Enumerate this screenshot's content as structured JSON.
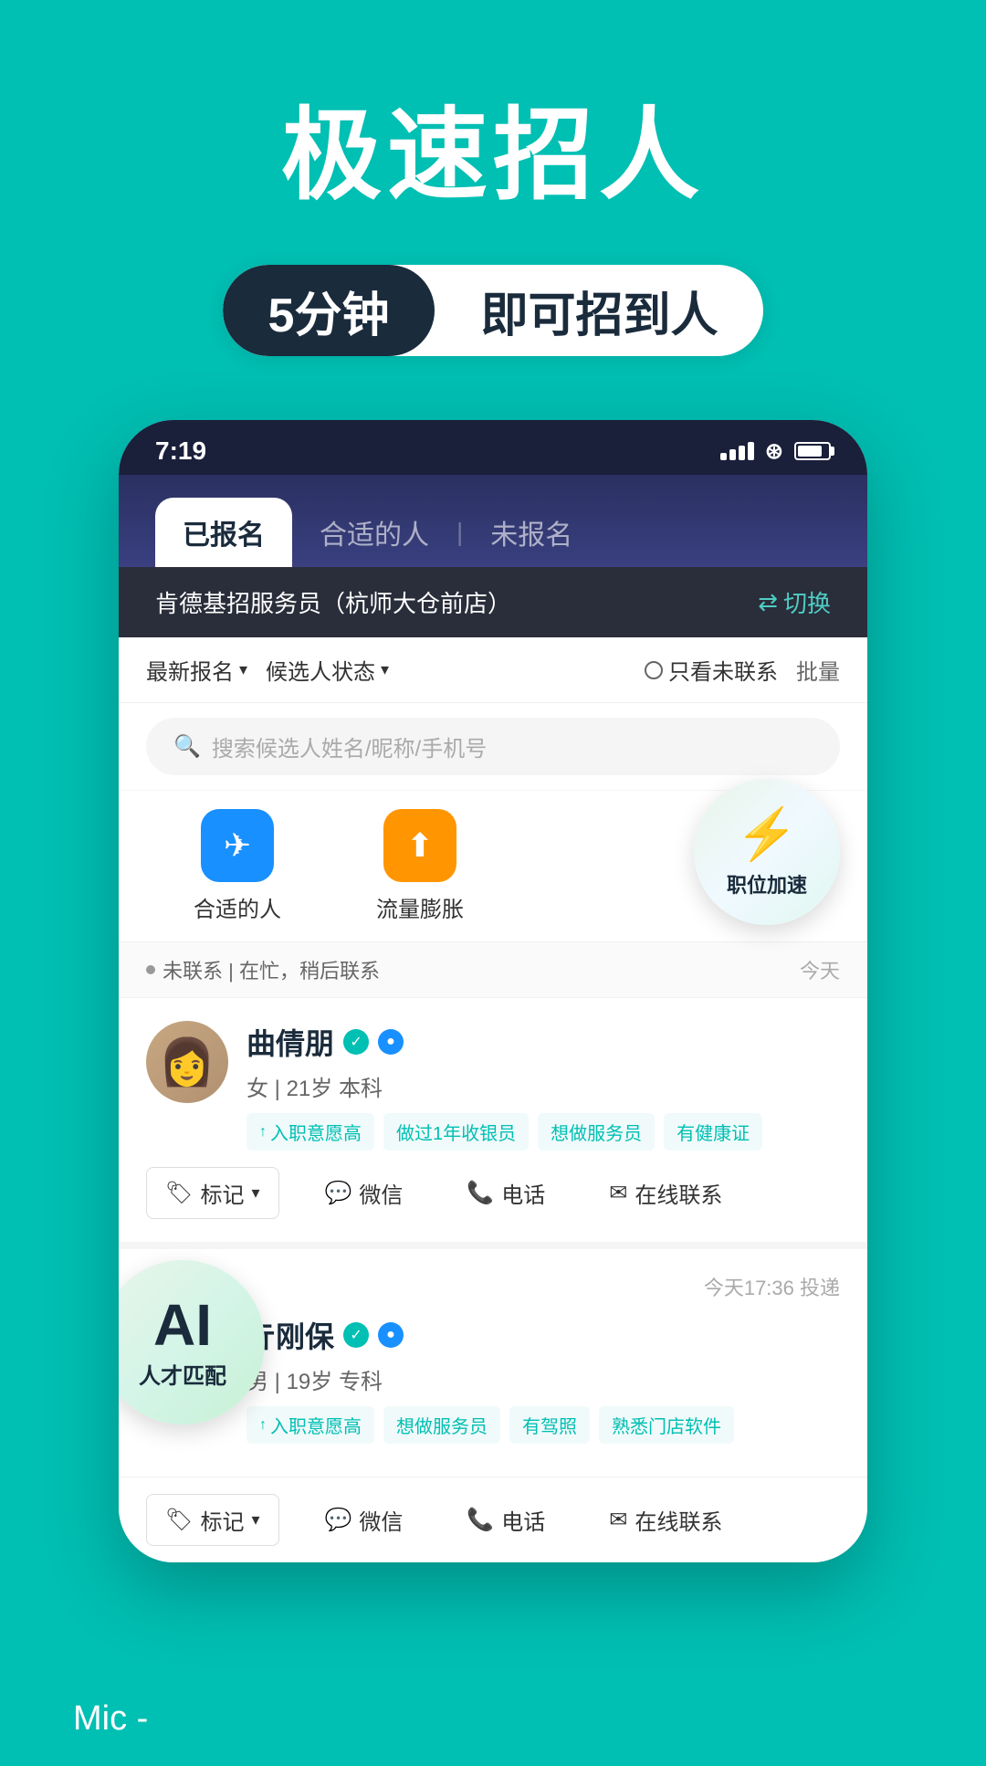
{
  "hero": {
    "title": "极速招人",
    "badge_left": "5分钟",
    "badge_right": "即可招到人"
  },
  "status_bar": {
    "time": "7:19"
  },
  "tabs": [
    {
      "label": "已报名",
      "active": true
    },
    {
      "label": "合适的人",
      "active": false
    },
    {
      "label": "未报名",
      "active": false
    }
  ],
  "job_bar": {
    "title": "肯德基招服务员（杭师大仓前店）",
    "switch_label": "切换"
  },
  "filter": {
    "sort_label": "最新报名",
    "status_label": "候选人状态",
    "uncontacted_label": "只看未联系",
    "batch_label": "批量"
  },
  "search": {
    "placeholder": "搜索候选人姓名/昵称/手机号"
  },
  "actions": [
    {
      "icon": "✈",
      "label": "合适的人",
      "color": "blue"
    },
    {
      "icon": "⬆",
      "label": "流量膨胀",
      "color": "orange"
    }
  ],
  "speed_boost": {
    "label": "职位加速"
  },
  "candidate_status": {
    "text": "未联系 | 在忙，稍后联系",
    "today_label": "今天"
  },
  "candidate1": {
    "name": "曲倩朋",
    "gender": "女",
    "age": "21岁",
    "education": "本科",
    "tags": [
      "入职意愿高",
      "做过1年收银员",
      "想做服务员",
      "有健康证"
    ],
    "actions": [
      "标记",
      "微信",
      "电话",
      "在线联系"
    ]
  },
  "ai_float": {
    "big_label": "AI",
    "small_label": "人才匹配"
  },
  "candidate2": {
    "name": "亓刚保",
    "gender": "男",
    "age": "19岁",
    "education": "专科",
    "timestamp": "今天17:36 投递",
    "tags": [
      "入职意愿高",
      "想做服务员",
      "有驾照",
      "熟悉门店软件"
    ],
    "actions": [
      "标记",
      "微信",
      "电话",
      "在线联系"
    ]
  },
  "mic_text": "Mic -"
}
